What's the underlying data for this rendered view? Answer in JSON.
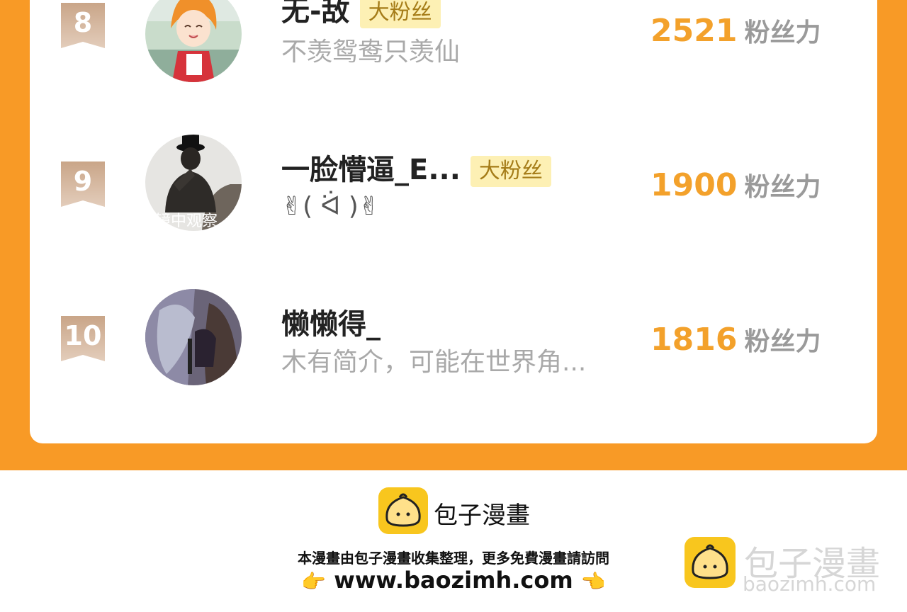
{
  "ranking": [
    {
      "rank": "8",
      "name": "无-敌",
      "badge": "大粉丝",
      "bio": "不羡鸳鸯只羡仙",
      "score": "2521",
      "unit": "粉丝力"
    },
    {
      "rank": "9",
      "name": "一脸懵逼_E...",
      "badge": "大粉丝",
      "bio": "✌( ᐛ )✌",
      "score": "1900",
      "unit": "粉丝力",
      "avatar_overlay": "镜中观察"
    },
    {
      "rank": "10",
      "name": "懒懒得_",
      "badge": "",
      "bio": "木有简介，可能在世界角...",
      "score": "1816",
      "unit": "粉丝力"
    }
  ],
  "footer": {
    "brand": "包子漫畫",
    "notice": "本漫畫由包子漫畫收集整理，更多免費漫畫請訪問",
    "url": "www.baozimh.com",
    "hand_left": "👉",
    "hand_right": "👈"
  },
  "watermark": {
    "title": "包子漫畫",
    "sub": "baozimh.com"
  },
  "colors": {
    "frame": "#f89a26",
    "score": "#f3a12b",
    "badge_bg": "#fdf0b4",
    "logo": "#f8c61e"
  }
}
